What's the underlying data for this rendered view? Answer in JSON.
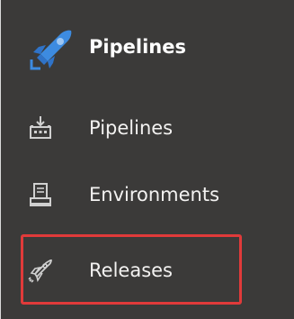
{
  "section": {
    "title": "Pipelines",
    "icon": "pipelines-logo-icon",
    "accent_color": "#2e7bd4"
  },
  "nav_items": [
    {
      "label": "Pipelines",
      "icon": "pipelines-icon"
    },
    {
      "label": "Environments",
      "icon": "environments-icon"
    },
    {
      "label": "Releases",
      "icon": "releases-rocket-icon",
      "highlighted": true
    }
  ],
  "colors": {
    "background": "#3b3a39",
    "text": "#f3f2f1",
    "highlight": "#e03a3a"
  }
}
